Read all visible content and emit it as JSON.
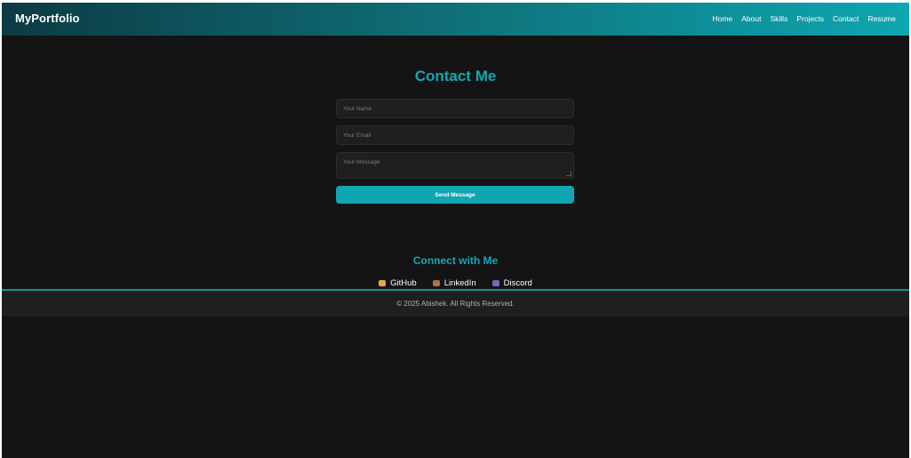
{
  "nav": {
    "brand": "MyPortfolio",
    "links": [
      "Home",
      "About",
      "Skills",
      "Projects",
      "Contact",
      "Resume"
    ]
  },
  "contact": {
    "title": "Contact Me",
    "name_placeholder": "Your Name",
    "email_placeholder": "Your Email",
    "message_placeholder": "Your Message",
    "send_label": "Send Message"
  },
  "connect": {
    "title": "Connect with Me",
    "links": [
      {
        "label": "GitHub",
        "icon": "cat-icon"
      },
      {
        "label": "LinkedIn",
        "icon": "briefcase-icon"
      },
      {
        "label": "Discord",
        "icon": "game-controller-icon"
      }
    ]
  },
  "footer": {
    "text": "© 2025 Abishek. All Rights Reserved."
  },
  "colors": {
    "accent": "#12a8b5",
    "background": "#141414",
    "field": "#1f1f1f"
  }
}
